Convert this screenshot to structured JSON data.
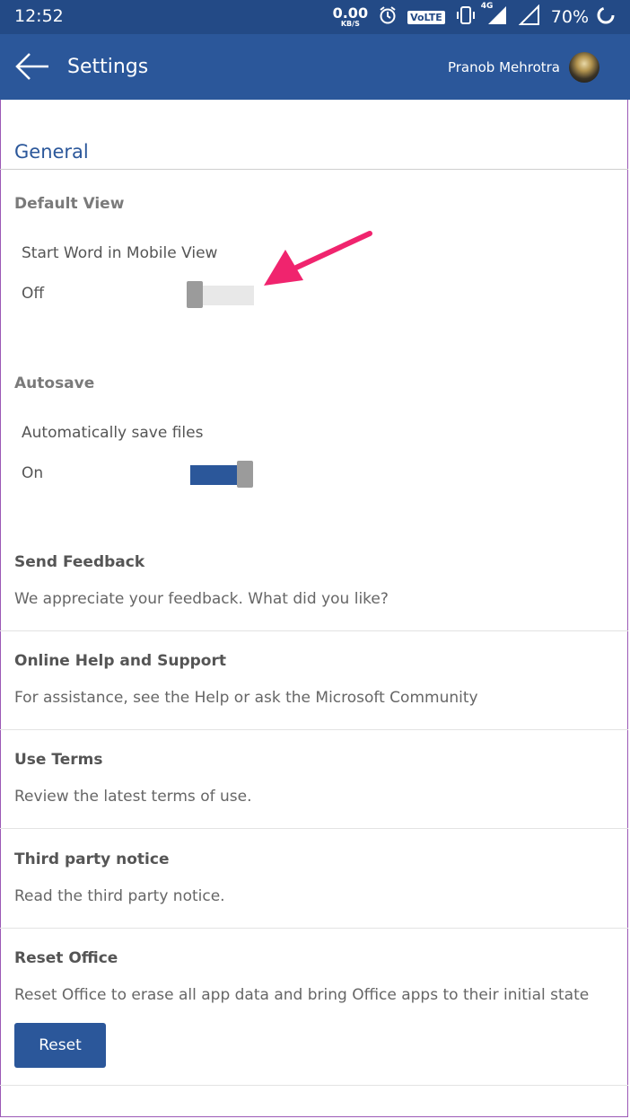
{
  "status_bar": {
    "time": "12:52",
    "net_speed_value": "0.00",
    "net_speed_unit": "KB/S",
    "volte": "VoLTE",
    "network": "4G",
    "battery": "70%"
  },
  "app_bar": {
    "title": "Settings",
    "user_name": "Pranob Mehrotra"
  },
  "general": {
    "heading": "General",
    "default_view": {
      "label": "Default View",
      "item": "Start Word in Mobile View",
      "state": "Off",
      "enabled": false
    },
    "autosave": {
      "label": "Autosave",
      "item": "Automatically save files",
      "state": "On",
      "enabled": true
    }
  },
  "links": [
    {
      "title": "Send Feedback",
      "desc": "We appreciate your feedback.  What did you like?"
    },
    {
      "title": "Online Help and Support",
      "desc": "For assistance, see the Help or ask the Microsoft Community"
    },
    {
      "title": "Use Terms",
      "desc": "Review the latest terms of use."
    },
    {
      "title": "Third party notice",
      "desc": "Read the third party notice."
    }
  ],
  "reset": {
    "title": "Reset Office",
    "desc": "Reset Office to erase all app data and bring Office apps to their initial state",
    "button": "Reset"
  },
  "colors": {
    "status_bar": "#234a86",
    "app_bar": "#2b579a",
    "accent": "#2b579a",
    "annotation_arrow": "#f0246e"
  }
}
